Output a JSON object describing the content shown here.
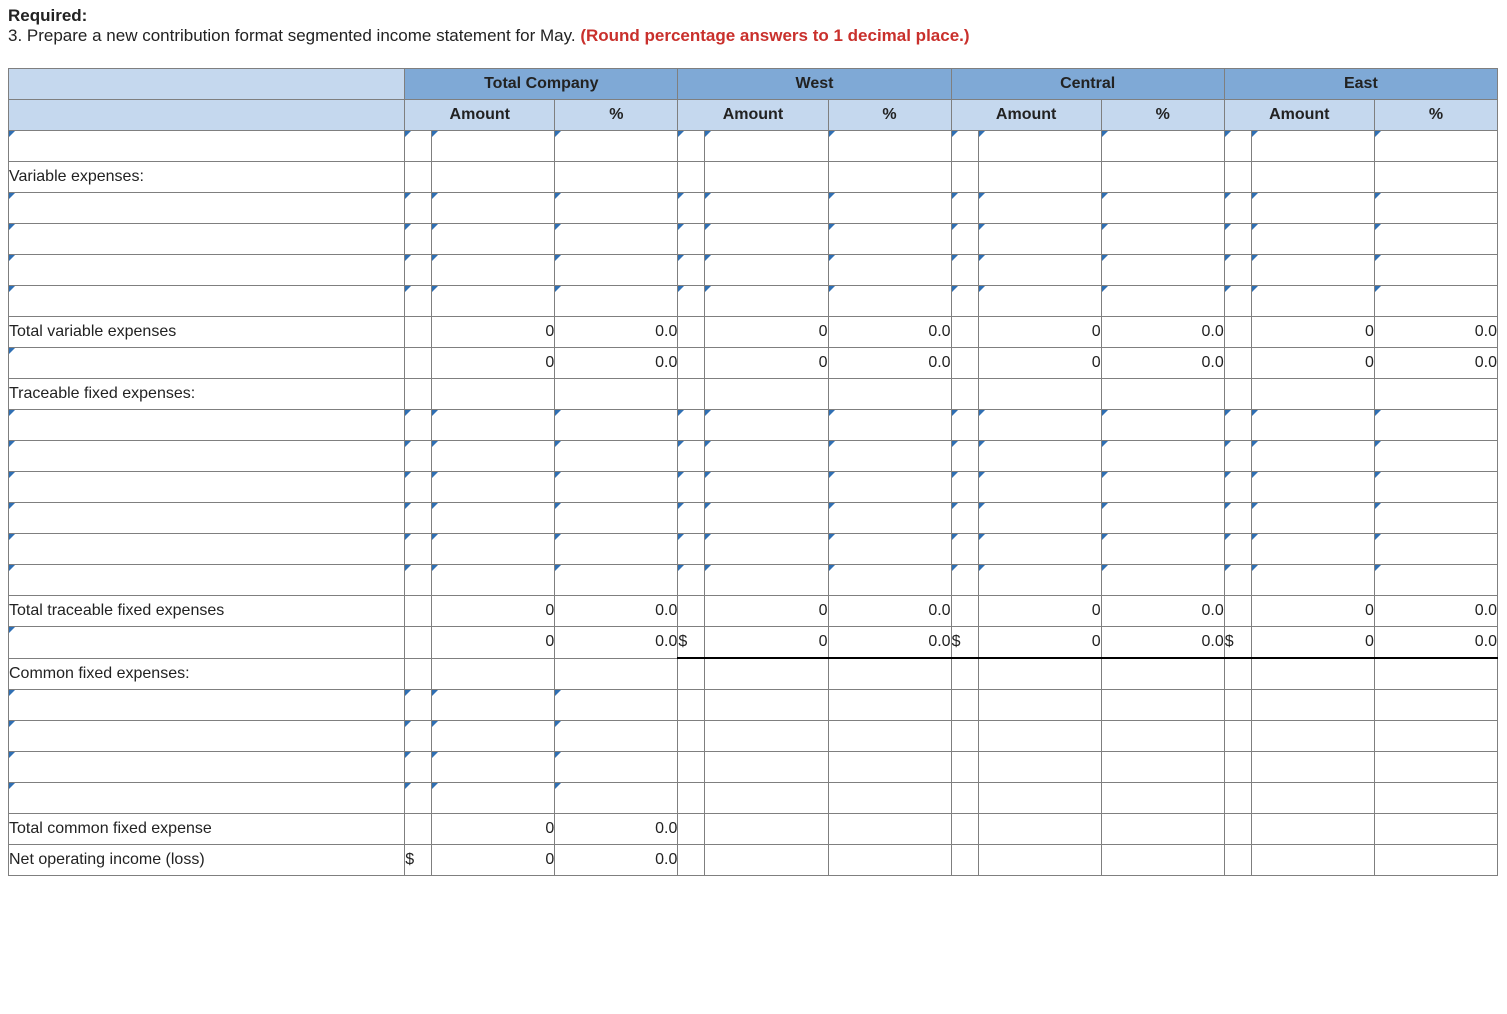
{
  "header": {
    "required_label": "Required:",
    "instruction_prefix": "3. Prepare a new contribution format segmented income statement for May. ",
    "instruction_red": "(Round percentage answers to 1 decimal place.)"
  },
  "columns": {
    "groups": [
      "Total Company",
      "West",
      "Central",
      "East"
    ],
    "sub": [
      "Amount",
      "%"
    ]
  },
  "labels": {
    "variable_expenses": "Variable expenses:",
    "total_variable_expenses": "Total variable expenses",
    "traceable_fixed_expenses": "Traceable fixed expenses:",
    "total_traceable_fixed_expenses": "Total traceable fixed expenses",
    "common_fixed_expenses": "Common fixed expenses:",
    "total_common_fixed_expense": "Total common fixed expense",
    "net_operating_income": "Net operating income (loss)"
  },
  "values": {
    "zero": "0",
    "zero_pct": "0.0",
    "dollar": "$"
  }
}
